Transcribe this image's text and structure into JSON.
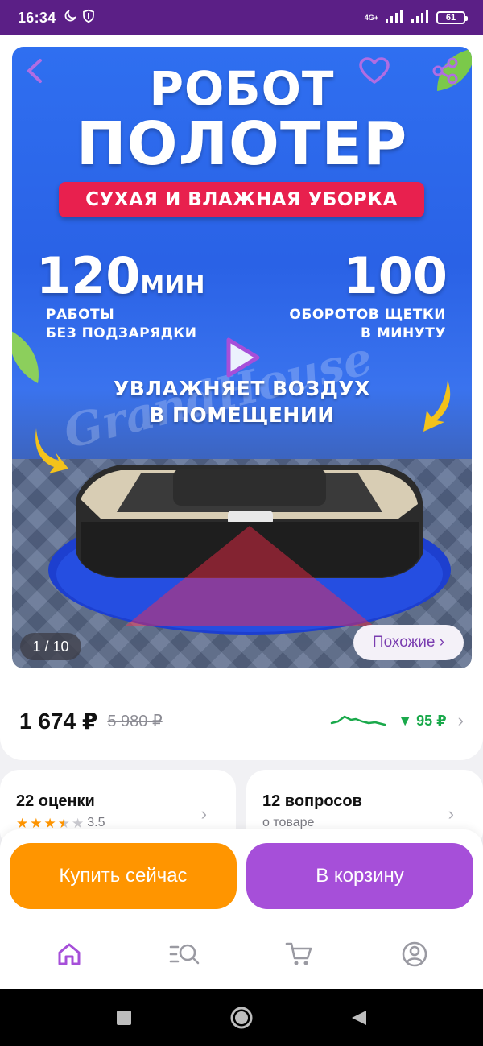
{
  "status_bar": {
    "time": "16:34",
    "network_label": "4G+",
    "battery": "61"
  },
  "gallery": {
    "promo": {
      "title_line1": "РОБОТ",
      "title_line2": "ПОЛОТЕР",
      "ribbon": "СУХАЯ И ВЛАЖНАЯ УБОРКА",
      "stat1_value": "120",
      "stat1_unit": "МИН",
      "stat1_caption_line1": "РАБОТЫ",
      "stat1_caption_line2": "БЕЗ ПОДЗАРЯДКИ",
      "stat2_value": "100",
      "stat2_caption_line1": "ОБОРОТОВ ЩЕТКИ",
      "stat2_caption_line2": "В МИНУТУ",
      "humidify_line1": "УВЛАЖНЯЕТ ВОЗДУХ",
      "humidify_line2": "В ПОМЕЩЕНИИ",
      "watermark": "GrandHouse"
    },
    "counter": "1 / 10",
    "similar_label": "Похожие ›",
    "icons": {
      "back": "chevron-left-icon",
      "favorite": "heart-icon",
      "share": "share-icon",
      "play": "play-icon"
    }
  },
  "price": {
    "current": "1 674 ₽",
    "old": "5 980 ₽",
    "drop": "▼ 95 ₽"
  },
  "reviews_card": {
    "title": "22 оценки",
    "rating": "3.5",
    "rating_value": 3.5,
    "rating_max": 5
  },
  "questions_card": {
    "title": "12 вопросов",
    "subtitle": "о товаре"
  },
  "actions": {
    "buy_now": "Купить сейчас",
    "add_to_cart": "В корзину"
  },
  "bottom_nav": {
    "items": [
      "home-icon",
      "catalog-search-icon",
      "cart-icon",
      "profile-icon"
    ],
    "active": "home-icon"
  },
  "colors": {
    "brand_purple": "#a64fd9",
    "status_bar": "#5b1f86",
    "buy_orange": "#ff9500",
    "price_drop_green": "#1aa94b",
    "ribbon_red": "#e8204e"
  }
}
